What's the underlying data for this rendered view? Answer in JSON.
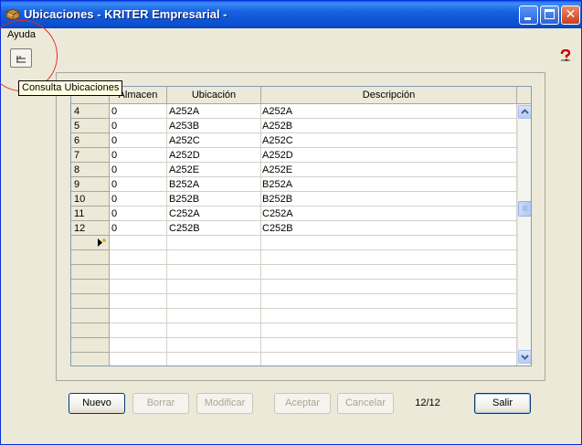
{
  "window": {
    "title": "Ubicaciones - KRITER Empresarial -"
  },
  "menu": {
    "items": [
      "Ayuda"
    ]
  },
  "tooltip": "Consulta Ubicaciones",
  "grid": {
    "columns": [
      "Almacen",
      "Ubicación",
      "Descripción"
    ],
    "rows": [
      {
        "num": "4",
        "almacen": "0",
        "ubicacion": "A252A",
        "descripcion": "A252A"
      },
      {
        "num": "5",
        "almacen": "0",
        "ubicacion": "A253B",
        "descripcion": "A252B"
      },
      {
        "num": "6",
        "almacen": "0",
        "ubicacion": "A252C",
        "descripcion": "A252C"
      },
      {
        "num": "7",
        "almacen": "0",
        "ubicacion": "A252D",
        "descripcion": "A252D"
      },
      {
        "num": "8",
        "almacen": "0",
        "ubicacion": "A252E",
        "descripcion": "A252E"
      },
      {
        "num": "9",
        "almacen": "0",
        "ubicacion": "B252A",
        "descripcion": "B252A"
      },
      {
        "num": "10",
        "almacen": "0",
        "ubicacion": "B252B",
        "descripcion": "B252B"
      },
      {
        "num": "11",
        "almacen": "0",
        "ubicacion": "C252A",
        "descripcion": "C252A"
      },
      {
        "num": "12",
        "almacen": "0",
        "ubicacion": "C252B",
        "descripcion": "C252B"
      }
    ],
    "new_row_icon": "new-row-pointer-icon",
    "scroll_position": 0.38
  },
  "buttons": {
    "nuevo": "Nuevo",
    "borrar": "Borrar",
    "modificar": "Modificar",
    "aceptar": "Aceptar",
    "cancelar": "Cancelar",
    "salir": "Salir"
  },
  "record_counter": "12/12",
  "colors": {
    "titlebar": "#0a4fd0",
    "window_bg": "#ece9d8",
    "annotation_circle": "#e32a2a",
    "help_icon": "#cc0000"
  }
}
